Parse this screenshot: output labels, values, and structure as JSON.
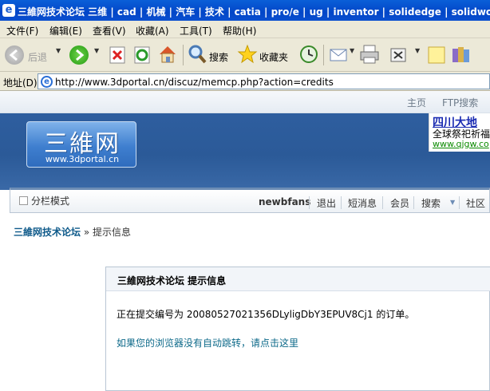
{
  "window": {
    "title": "三維网技术论坛 三维 | cad | 机械 | 汽车 | 技术 | catia | pro/e | ug | inventor | solidedge | solidworks | caxa - Pow"
  },
  "menu": [
    "文件(F)",
    "编辑(E)",
    "查看(V)",
    "收藏(A)",
    "工具(T)",
    "帮助(H)"
  ],
  "toolbar": {
    "back_label": "后退",
    "search_label": "搜索",
    "favorites_label": "收藏夹"
  },
  "address": {
    "label": "地址(D)",
    "url": "http://www.3dportal.cn/discuz/memcp.php?action=credits"
  },
  "site": {
    "top_links": [
      "主页",
      "FTP搜索"
    ],
    "logo_text": "三維网",
    "logo_url": "www.3dportal.cn",
    "ad": {
      "line1": "四川大地",
      "line2": "全球祭祀祈福",
      "line3": "www.qjgw.co"
    },
    "nav": {
      "mode": "分栏模式",
      "username": "newbfans",
      "items": [
        "退出",
        "短消息",
        "会员",
        "搜索",
        "社区"
      ]
    },
    "breadcrumb": {
      "home": "三維网技术论坛",
      "separator": "»",
      "current": "提示信息"
    },
    "message": {
      "header": "三維网技术论坛  提示信息",
      "body": "正在提交编号为 20080527021356DLyligDbY3EPUV8Cj1 的订单。",
      "redirect": "如果您的浏览器没有自动跳转，请点击这里"
    }
  },
  "colors": {
    "titlebar": "#0a5fd8",
    "banner": "#2e5e9f",
    "link": "#0e6a8a"
  }
}
